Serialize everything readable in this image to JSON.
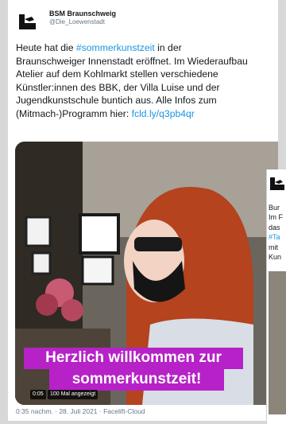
{
  "tweet": {
    "author_name": "BSM Braunschweig",
    "author_handle": "@Die_Loewenstadt",
    "lines": [
      {
        "pre": "Heute hat die ",
        "link": "#sommerkunstzeit",
        "post": " in der"
      },
      {
        "pre": "Braunschweiger Innenstadt eröffnet. Im Wiederaufbau",
        "link": "",
        "post": ""
      },
      {
        "pre": "Atelier auf dem Kohlmarkt stellen verschiedene",
        "link": "",
        "post": ""
      },
      {
        "pre": "Künstler:innen des BBK, der Villa Luise und der",
        "link": "",
        "post": ""
      },
      {
        "pre": "Jugendkunstschule buntich aus. Alle Infos zum",
        "link": "",
        "post": ""
      },
      {
        "pre": "(Mitmach-)Programm hier: ",
        "link": "fcld.ly/q3pb4qr",
        "post": ""
      }
    ],
    "timestamp": "0:35 nachm. · 28. Juli 2021 · Facelift-Cloud"
  },
  "video": {
    "caption_line1": "Herzlich willkommen zur",
    "caption_line2": "sommerkunstzeit!",
    "time": "0:05",
    "views": "100 Mal angezeigt"
  },
  "inset_tweet": {
    "lines": [
      "Bur",
      "Im F",
      "das",
      "#Ta",
      "mit",
      "Kun"
    ]
  },
  "colors": {
    "link": "#1b95e0",
    "caption_bg": "#b622c7",
    "text": "#14171a",
    "muted": "#657786"
  }
}
